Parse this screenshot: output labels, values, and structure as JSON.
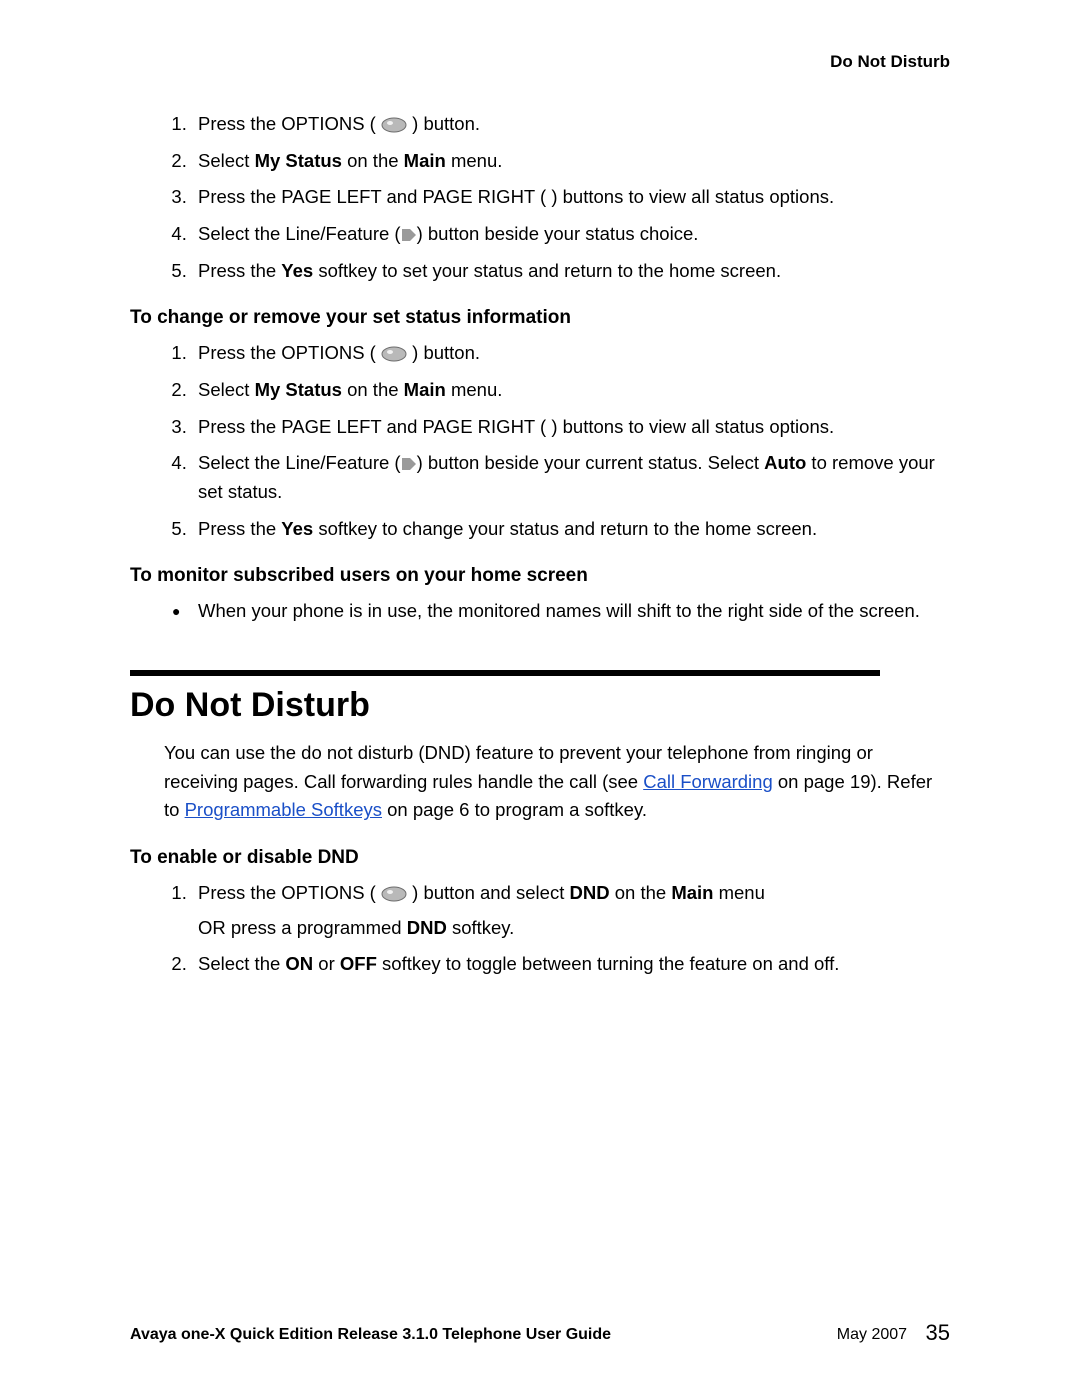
{
  "runningHead": "Do Not Disturb",
  "sectionA": {
    "steps": [
      {
        "pre": "Press the OPTIONS ( ",
        "icon": "oval",
        "post": " ) button."
      },
      {
        "parts": [
          "Select ",
          {
            "b": "My Status"
          },
          " on the ",
          {
            "b": "Main"
          },
          " menu."
        ]
      },
      {
        "pre": "Press the PAGE LEFT and PAGE RIGHT (       ) buttons to view all status options."
      },
      {
        "parts": [
          "Select the Line/Feature (",
          {
            "icon": "flag"
          },
          ") button beside your status choice."
        ]
      },
      {
        "parts": [
          "Press the ",
          {
            "b": "Yes"
          },
          " softkey to set your status and return to the home screen."
        ]
      }
    ]
  },
  "sectionB": {
    "title": "To change or remove your set status information",
    "steps": [
      {
        "pre": "Press the OPTIONS ( ",
        "icon": "oval",
        "post": " ) button."
      },
      {
        "parts": [
          "Select ",
          {
            "b": "My Status"
          },
          " on the ",
          {
            "b": "Main"
          },
          " menu."
        ]
      },
      {
        "pre": "Press the PAGE LEFT and PAGE RIGHT (       ) buttons to view all status options."
      },
      {
        "parts": [
          "Select the Line/Feature (",
          {
            "icon": "flag"
          },
          ") button beside your current status. Select ",
          {
            "b": "Auto"
          },
          " to remove your set status."
        ]
      },
      {
        "parts": [
          "Press the ",
          {
            "b": "Yes"
          },
          " softkey to change your status and return to the home screen."
        ]
      }
    ]
  },
  "sectionC": {
    "title": "To monitor subscribed users on your home screen",
    "bullets": [
      "When your phone is in use, the monitored names will shift to the right side of the screen."
    ]
  },
  "dnd": {
    "title": "Do Not Disturb",
    "para1_pre": "You can use the do not disturb (DND) feature to prevent your telephone from ringing or receiving pages. Call forwarding rules handle the call (see ",
    "link1": "Call Forwarding",
    "para1_mid": " on page 19). Refer to  ",
    "link2": "Programmable Softkeys",
    "para1_post": " on page 6 to program a softkey.",
    "sub": "To enable or disable DND",
    "steps": [
      {
        "line1": {
          "parts": [
            "Press the OPTIONS ( ",
            {
              "icon": "oval"
            },
            " ) button and select ",
            {
              "b": "DND"
            },
            " on the ",
            {
              "b": "Main"
            },
            " menu"
          ]
        },
        "line2": {
          "parts": [
            "OR press a programmed ",
            {
              "b": "DND"
            },
            " softkey."
          ]
        }
      },
      {
        "line1": {
          "parts": [
            "Select the ",
            {
              "b": "ON"
            },
            " or ",
            {
              "b": "OFF"
            },
            " softkey to toggle between turning the feature on and off."
          ]
        }
      }
    ]
  },
  "footer": {
    "left": "Avaya one-X Quick Edition Release 3.1.0 Telephone User Guide",
    "date": "May 2007",
    "page": "35"
  }
}
